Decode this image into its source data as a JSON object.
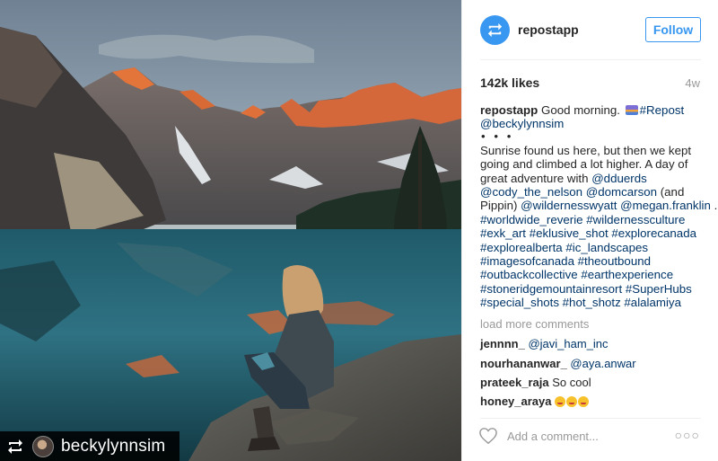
{
  "post": {
    "username": "repostapp",
    "follow_label": "Follow",
    "likes": "142k likes",
    "time_ago": "4w",
    "caption": {
      "author": "repostapp",
      "line1_text": "Good morning.",
      "line1_tag": "#Repost",
      "line2_mention": "@beckylynnsim",
      "dots": "• • •",
      "lines": [
        [
          {
            "t": "Sunrise found us here, but then we kept",
            "c": "plain"
          }
        ],
        [
          {
            "t": "going and climbed a lot higher. A day of",
            "c": "plain"
          }
        ],
        [
          {
            "t": "great adventure with ",
            "c": "plain"
          },
          {
            "t": "@dduerds",
            "c": "link"
          }
        ],
        [
          {
            "t": "@cody_the_nelson",
            "c": "link"
          },
          {
            "t": " ",
            "c": "plain"
          },
          {
            "t": "@domcarson",
            "c": "link"
          },
          {
            "t": " (and",
            "c": "plain"
          }
        ],
        [
          {
            "t": "Pippin) ",
            "c": "plain"
          },
          {
            "t": "@wildernesswyatt",
            "c": "link"
          },
          {
            "t": " ",
            "c": "plain"
          },
          {
            "t": "@megan.franklin",
            "c": "link"
          },
          {
            "t": " .",
            "c": "plain"
          }
        ],
        [
          {
            "t": "#worldwide_reverie #wildernessculture",
            "c": "link"
          }
        ],
        [
          {
            "t": "#exk_art #eklusive_shot #explorecanada",
            "c": "link"
          }
        ],
        [
          {
            "t": "#explorealberta #ic_landscapes",
            "c": "link"
          }
        ],
        [
          {
            "t": "#imagesofcanada #theoutbound",
            "c": "link"
          }
        ],
        [
          {
            "t": "#outbackcollective #earthexperience",
            "c": "link"
          }
        ],
        [
          {
            "t": "#stoneridgemountainresort #SuperHubs",
            "c": "link"
          }
        ],
        [
          {
            "t": "#special_shots #hot_shotz #alalamiya",
            "c": "link"
          }
        ]
      ]
    },
    "load_more": "load more comments",
    "comments": [
      {
        "user": "jennnn_",
        "text": "@javi_ham_inc",
        "is_link": true
      },
      {
        "user": "nourhananwar_",
        "text": "@aya.anwar",
        "is_link": true
      },
      {
        "user": "prateek_raja",
        "text": "So cool",
        "is_link": false
      },
      {
        "user": "honey_araya",
        "text": "",
        "emoji_count": 3,
        "is_link": false
      }
    ],
    "add_comment_placeholder": "Add a comment...",
    "more_icon": "ellipsis-icon",
    "heart_icon": "heart-outline-icon"
  },
  "photo": {
    "repost_username": "beckylynnsim",
    "repost_icon": "repost-icon"
  },
  "colors": {
    "accent": "#3897f0",
    "link": "#003569",
    "muted": "#999999"
  }
}
